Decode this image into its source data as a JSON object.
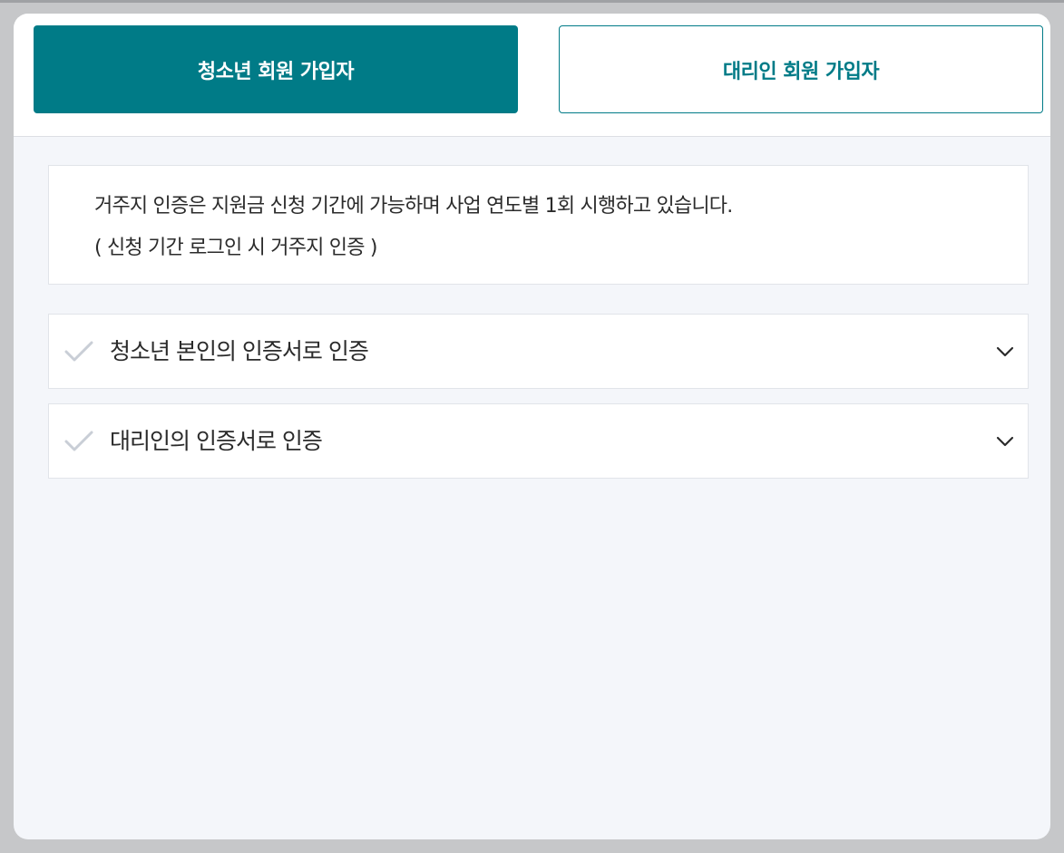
{
  "tabs": {
    "youth": {
      "label": "청소년 회원 가입자",
      "active": true
    },
    "proxy": {
      "label": "대리인 회원 가입자",
      "active": false
    }
  },
  "notice": {
    "line1": "거주지 인증은 지원금 신청 기간에 가능하며 사업 연도별 1회 시행하고 있습니다.",
    "line2": "( 신청 기간 로그인 시 거주지 인증 )"
  },
  "accordions": [
    {
      "label": "청소년 본인의 인증서로 인증",
      "icon": "check-icon",
      "toggle_icon": "chevron-down-icon"
    },
    {
      "label": "대리인의 인증서로 인증",
      "icon": "check-icon",
      "toggle_icon": "chevron-down-icon"
    }
  ],
  "colors": {
    "accent": "#007b87",
    "background": "#f4f6fa",
    "overlay": "#c6c7c9",
    "check": "#c9ced6"
  }
}
